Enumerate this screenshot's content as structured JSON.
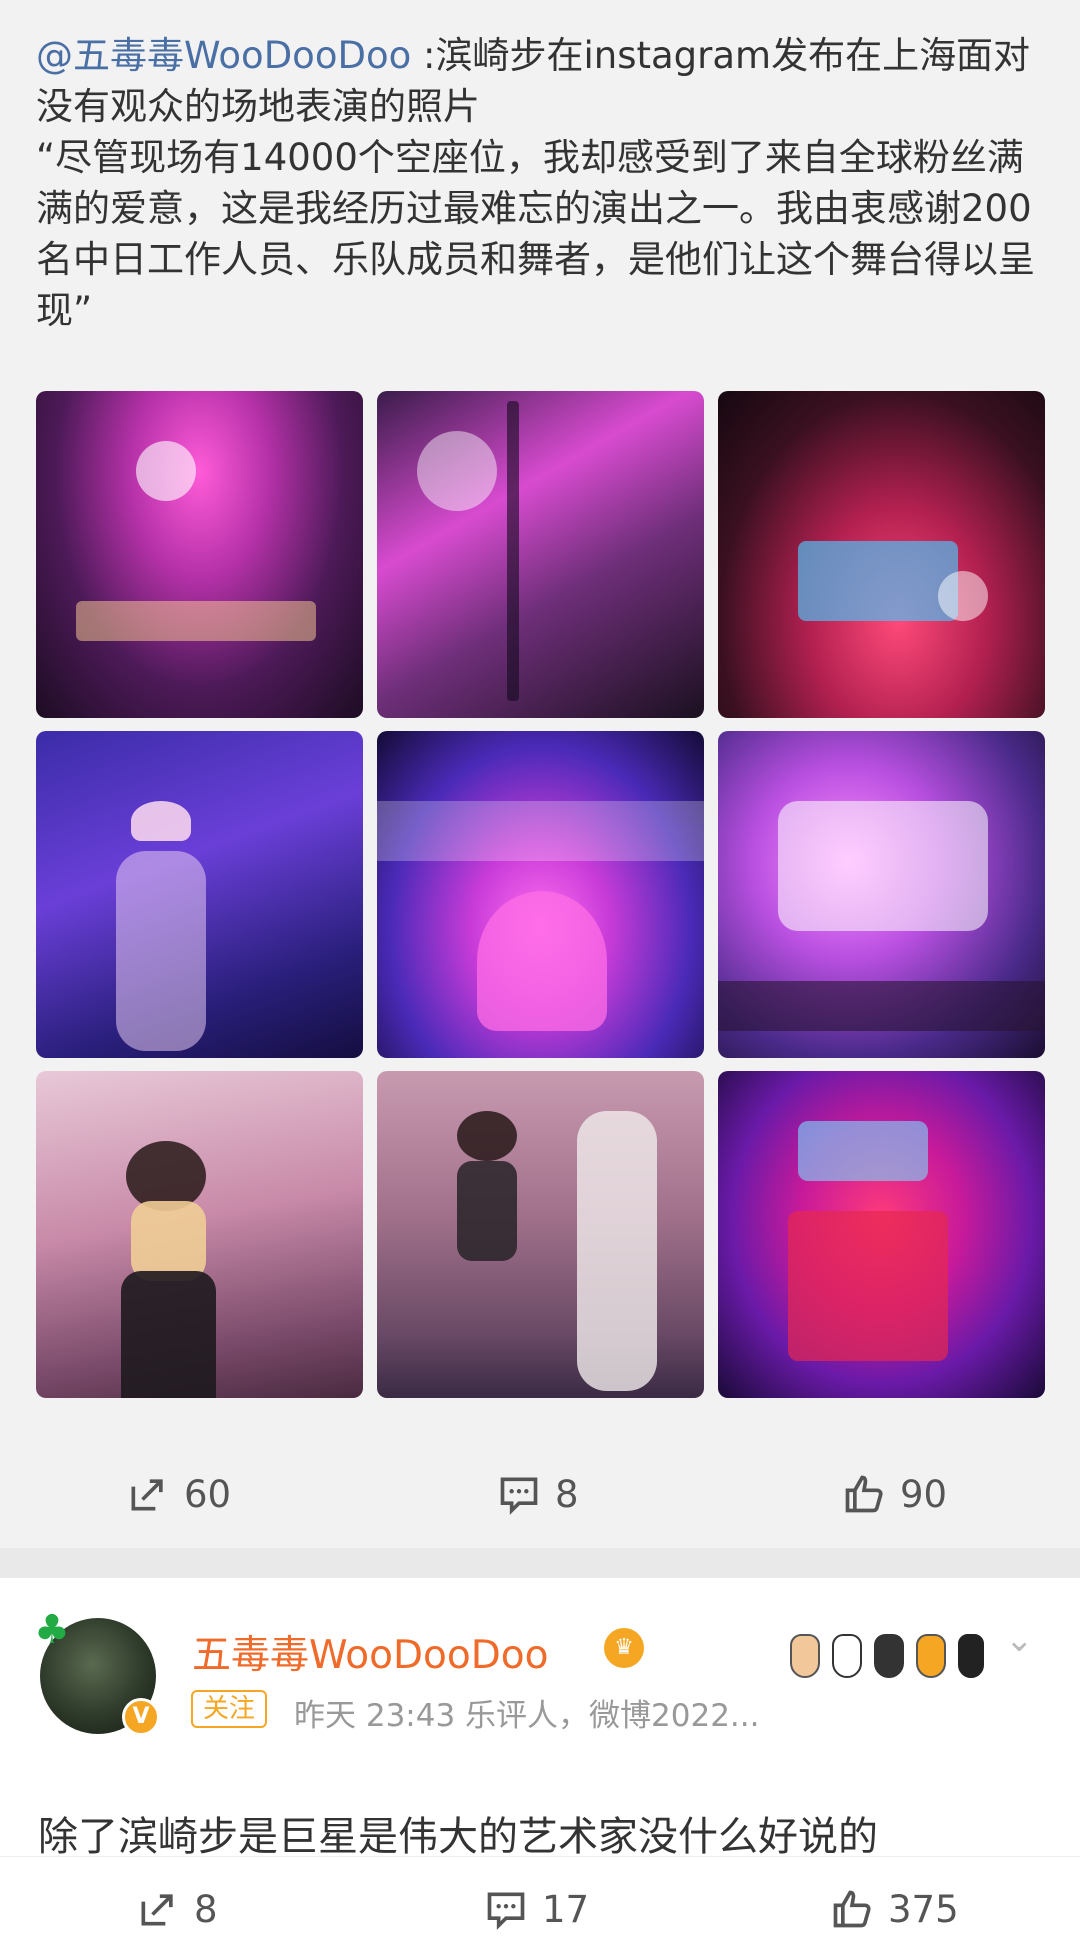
{
  "repost": {
    "mention": "@五毒毒WooDooDoo",
    "text": " :滨崎步在instagram发布在上海面对没有观众的场地表演的照片\n“尽管现场有14000个空座位，我却感受到了来自全球粉丝满满的爱意，这是我经历过最难忘的演出之一。我由衷感谢200名中日工作人员、乐队成员和舞者，是他们让这个舞台得以呈现”",
    "actions": {
      "share_count": "60",
      "comment_count": "8",
      "like_count": "90"
    }
  },
  "author": {
    "name": "五毒毒WooDooDoo",
    "follow_label": "关注",
    "meta": "昨天 23:43  乐评人，微博2022...",
    "comment": "除了滨崎步是巨星是伟大的艺术家没什么好说的"
  },
  "bottom_actions": {
    "share_count": "8",
    "comment_count": "17",
    "like_count": "375"
  },
  "colors": {
    "mention": "#4a6fa5",
    "author_name": "#f06a2a",
    "badge": "#f5a623"
  },
  "icons": {
    "share": "share-icon",
    "comment": "comment-icon",
    "like": "thumbs-up-icon",
    "verified": "verified-badge-icon",
    "chevron": "chevron-down-icon"
  }
}
